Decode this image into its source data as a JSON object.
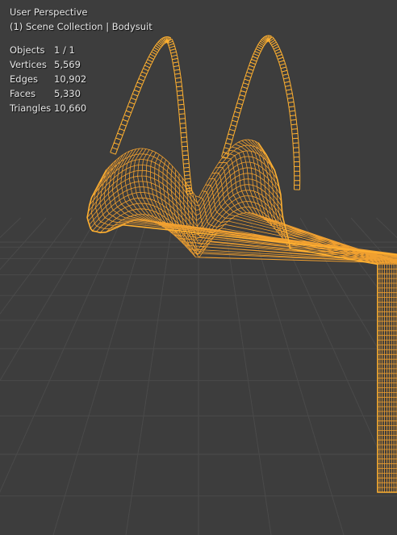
{
  "viewport": {
    "view_name": "User Perspective",
    "collection_line": "(1) Scene Collection | Bodysuit"
  },
  "stats": [
    {
      "label": "Objects",
      "value": "1 / 1"
    },
    {
      "label": "Vertices",
      "value": "5,569"
    },
    {
      "label": "Edges",
      "value": "10,902"
    },
    {
      "label": "Faces",
      "value": "5,330"
    },
    {
      "label": "Triangles",
      "value": "10,660"
    }
  ],
  "colors": {
    "background": "#3d3d3d",
    "grid": "#4a4a4a",
    "wire": "#f0a030",
    "wire_outline": "#ffb030",
    "text": "#e6e6e6"
  }
}
